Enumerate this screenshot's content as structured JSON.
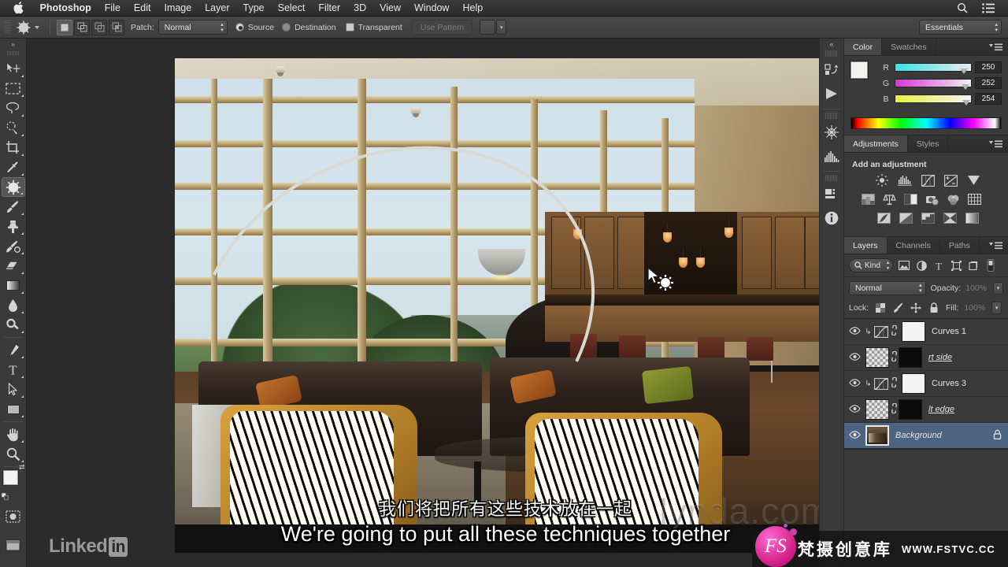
{
  "menubar": {
    "apple_icon": "apple-logo",
    "items": [
      {
        "label": "Photoshop",
        "bold": true
      },
      {
        "label": "File"
      },
      {
        "label": "Edit"
      },
      {
        "label": "Image"
      },
      {
        "label": "Layer"
      },
      {
        "label": "Type"
      },
      {
        "label": "Select"
      },
      {
        "label": "Filter"
      },
      {
        "label": "3D"
      },
      {
        "label": "View"
      },
      {
        "label": "Window"
      },
      {
        "label": "Help"
      }
    ],
    "search_icon": "search-icon",
    "menu_icon": "list-menu-icon"
  },
  "options_bar": {
    "tool_icon": "patch-tool-icon",
    "selection_modes": [
      "new-selection",
      "add-to-selection",
      "subtract-from-selection",
      "intersect-selection"
    ],
    "patch_label": "Patch:",
    "patch_mode": "Normal",
    "source_label": "Source",
    "destination_label": "Destination",
    "transparent_label": "Transparent",
    "use_pattern_label": "Use Pattern",
    "workspace": "Essentials"
  },
  "toolbar": {
    "tools": [
      {
        "name": "move-tool",
        "selected": false
      },
      {
        "name": "rectangular-marquee-tool",
        "selected": false
      },
      {
        "name": "lasso-tool",
        "selected": false
      },
      {
        "name": "quick-selection-tool",
        "selected": false
      },
      {
        "name": "crop-tool",
        "selected": false
      },
      {
        "name": "eyedropper-tool",
        "selected": false
      },
      {
        "name": "patch-tool",
        "selected": true
      },
      {
        "name": "brush-tool",
        "selected": false
      },
      {
        "name": "clone-stamp-tool",
        "selected": false
      },
      {
        "name": "history-brush-tool",
        "selected": false
      },
      {
        "name": "eraser-tool",
        "selected": false
      },
      {
        "name": "gradient-tool",
        "selected": false
      },
      {
        "name": "blur-tool",
        "selected": false
      },
      {
        "name": "dodge-tool",
        "selected": false
      },
      {
        "name": "pen-tool",
        "selected": false
      },
      {
        "name": "horizontal-type-tool",
        "selected": false
      },
      {
        "name": "path-selection-tool",
        "selected": false
      },
      {
        "name": "rectangle-tool",
        "selected": false
      },
      {
        "name": "hand-tool",
        "selected": false
      },
      {
        "name": "zoom-tool",
        "selected": false
      }
    ],
    "foreground_color": "#f3f3f1",
    "background_color": "#8a6a4f",
    "quick_mask_icon": "quick-mask-icon",
    "screen_mode_icon": "screen-mode-icon"
  },
  "icon_rail": {
    "buttons": [
      "history-icon",
      "actions-play-icon",
      "3d-icon",
      "histogram-icon",
      "properties-icon",
      "info-icon"
    ]
  },
  "color_panel": {
    "tabs": [
      {
        "label": "Color",
        "active": true
      },
      {
        "label": "Swatches",
        "active": false
      }
    ],
    "channels": [
      {
        "label": "R",
        "value": "250"
      },
      {
        "label": "G",
        "value": "252"
      },
      {
        "label": "B",
        "value": "254"
      }
    ]
  },
  "adjustments_panel": {
    "tabs": [
      {
        "label": "Adjustments",
        "active": true
      },
      {
        "label": "Styles",
        "active": false
      }
    ],
    "title": "Add an adjustment",
    "row1": [
      "brightness-contrast-icon",
      "levels-icon",
      "curves-icon",
      "exposure-icon",
      "vibrance-icon"
    ],
    "row2": [
      "hue-saturation-icon",
      "color-balance-icon",
      "black-white-icon",
      "photo-filter-icon",
      "channel-mixer-icon",
      "color-lookup-icon"
    ],
    "row3": [
      "invert-icon",
      "posterize-icon",
      "threshold-icon",
      "gradient-map-icon",
      "selective-color-icon"
    ]
  },
  "layers_panel": {
    "tabs": [
      {
        "label": "Layers",
        "active": true
      },
      {
        "label": "Channels",
        "active": false
      },
      {
        "label": "Paths",
        "active": false
      }
    ],
    "filter_label": "Kind",
    "filter_icons": [
      "pixel-filter-icon",
      "adjustment-filter-icon",
      "type-filter-icon",
      "shape-filter-icon",
      "smart-object-filter-icon",
      "filter-toggle-icon"
    ],
    "blend_mode": "Normal",
    "opacity_label": "Opacity:",
    "opacity_value": "100%",
    "lock_label": "Lock:",
    "lock_icons": [
      "lock-transparent-icon",
      "lock-image-icon",
      "lock-position-icon",
      "lock-all-icon"
    ],
    "fill_label": "Fill:",
    "fill_value": "100%",
    "layers": [
      {
        "name": "Curves 1",
        "type": "adjustment",
        "visible": true,
        "clipped": true,
        "selected": false,
        "locked": false,
        "mask": "white"
      },
      {
        "name": "rt side",
        "type": "pixel",
        "visible": true,
        "clipped": false,
        "selected": false,
        "locked": false,
        "mask": "black",
        "italic_underline": true
      },
      {
        "name": "Curves 3",
        "type": "adjustment",
        "visible": true,
        "clipped": true,
        "selected": false,
        "locked": false,
        "mask": "white"
      },
      {
        "name": "lt edge",
        "type": "pixel",
        "visible": true,
        "clipped": false,
        "selected": false,
        "locked": false,
        "mask": "black",
        "italic_underline": true
      },
      {
        "name": "Background",
        "type": "photo",
        "visible": true,
        "clipped": false,
        "selected": true,
        "locked": true,
        "italic": true
      }
    ]
  },
  "canvas": {
    "subtitle_cn": "我们将把所有这些技术放在一起",
    "subtitle_en": "We're going to put all these techniques together",
    "ghost_watermark": "lynda.com",
    "cursor_icon": "patch-tool-cursor"
  },
  "branding": {
    "linkedin_text": "Linked",
    "linkedin_badge": "in",
    "fs_badge": "FS",
    "fs_name": "梵摄创意库",
    "fs_url": "WWW.FSTVC.CC"
  }
}
